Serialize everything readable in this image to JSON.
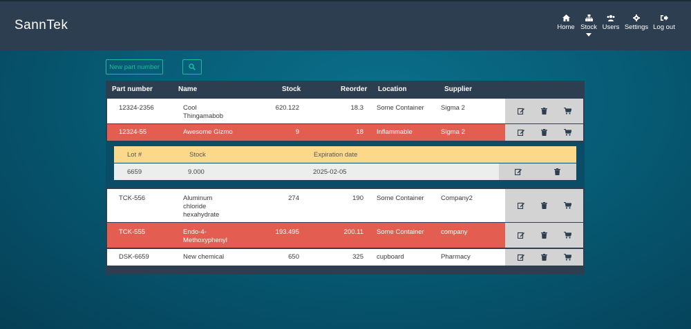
{
  "app": {
    "brand": "SannTek"
  },
  "nav": [
    {
      "label": "Home",
      "icon": "home-icon"
    },
    {
      "label": "Stock",
      "icon": "sitemap-icon",
      "active": true
    },
    {
      "label": "Users",
      "icon": "users-icon"
    },
    {
      "label": "Settings",
      "icon": "gear-icon"
    },
    {
      "label": "Log out",
      "icon": "logout-icon"
    }
  ],
  "toolbar": {
    "new_part_label": "New part number",
    "search_icon": "search-icon"
  },
  "table": {
    "headers": [
      "Part number",
      "Name",
      "Stock",
      "Reorder",
      "Location",
      "Supplier"
    ],
    "rows": [
      {
        "part": "12324-2356",
        "name_lines": [
          "Cool",
          "Thingamabob"
        ],
        "stock": "620.122",
        "reorder": "18.3",
        "location": "Some Container",
        "supplier": "Sigma 2",
        "highlight": false
      },
      {
        "part": "12324-55",
        "name_lines": [
          "Awesome Gizmo"
        ],
        "stock": "9",
        "reorder": "18",
        "location": "Inflammable",
        "supplier": "Sigma 2",
        "highlight": true
      },
      {
        "part": "TCK-556",
        "name_lines": [
          "Aluminum",
          "chloride",
          "hexahydrate"
        ],
        "stock": "274",
        "reorder": "190",
        "location": "Some Container",
        "supplier": "Company2",
        "highlight": false
      },
      {
        "part": "TCK-555",
        "name_lines": [
          "Endo-4-",
          "Methoxyphenyl"
        ],
        "stock": "193.495",
        "reorder": "200.11",
        "location": "Some Container",
        "supplier": "company",
        "highlight": true
      },
      {
        "part": "DSK-6659",
        "name_lines": [
          "New chemical"
        ],
        "stock": "650",
        "reorder": "325",
        "location": "cupboard",
        "supplier": "Pharmacy",
        "highlight": false
      }
    ]
  },
  "lots": {
    "headers": [
      "Lot #",
      "Stock",
      "Expiration date"
    ],
    "rows": [
      {
        "lot": "6659",
        "stock": "9.000",
        "expiration": "2025-02-05"
      }
    ]
  },
  "colors": {
    "topbar": "#2c3e50",
    "accent": "#1bbc9b",
    "alert_row": "#e35e50",
    "lot_header": "#fcd88b"
  }
}
